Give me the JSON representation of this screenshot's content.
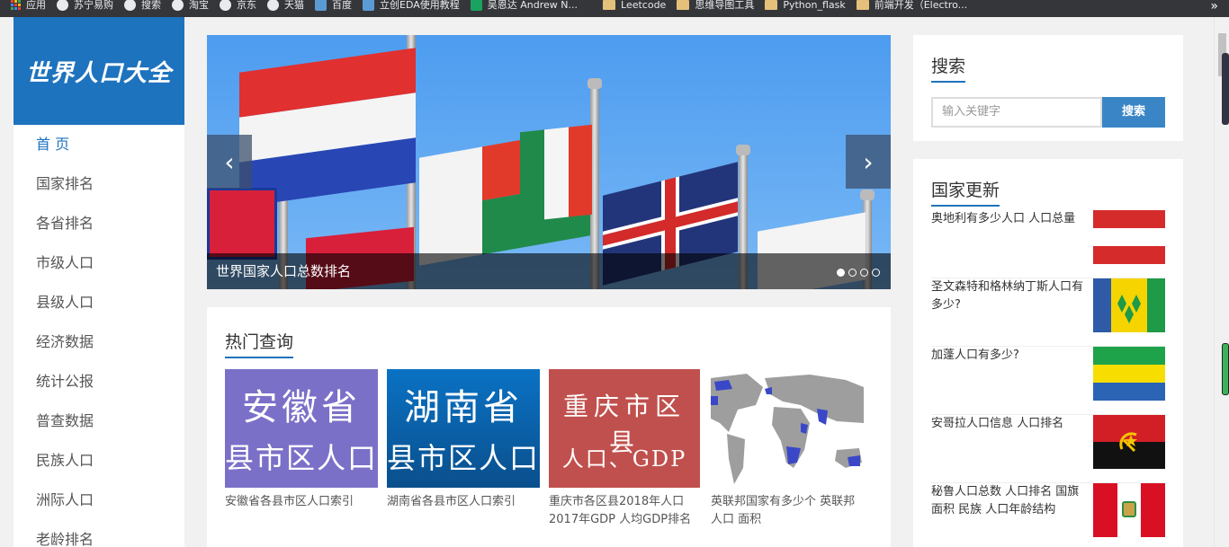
{
  "bookmarks": [
    {
      "label": "应用",
      "icon": "apps-grid-icon"
    },
    {
      "label": "苏宁易购",
      "icon": "globe-icon"
    },
    {
      "label": "搜索",
      "icon": "globe-icon"
    },
    {
      "label": "淘宝",
      "icon": "globe-icon"
    },
    {
      "label": "京东",
      "icon": "globe-icon"
    },
    {
      "label": "天猫",
      "icon": "globe-icon"
    },
    {
      "label": "百度",
      "icon": "baidu-icon"
    },
    {
      "label": "立创EDA使用教程",
      "icon": "link-icon"
    },
    {
      "label": "吴恩达 Andrew N...",
      "icon": "green-site-icon"
    },
    {
      "label": "Leetcode",
      "icon": "folder-icon"
    },
    {
      "label": "思维导图工具",
      "icon": "folder-icon"
    },
    {
      "label": "Python_flask",
      "icon": "folder-icon"
    },
    {
      "label": "前端开发（Electro...",
      "icon": "folder-icon"
    }
  ],
  "bookmarks_more": "»",
  "site": {
    "logo_text": "世界人口大全"
  },
  "nav": [
    {
      "label": "首 页",
      "active": true
    },
    {
      "label": "国家排名"
    },
    {
      "label": "各省排名"
    },
    {
      "label": "市级人口"
    },
    {
      "label": "县级人口"
    },
    {
      "label": "经济数据"
    },
    {
      "label": "统计公报"
    },
    {
      "label": "普查数据"
    },
    {
      "label": "民族人口"
    },
    {
      "label": "洲际人口"
    },
    {
      "label": "老龄排名"
    }
  ],
  "slider": {
    "caption": "世界国家人口总数排名",
    "prev": "‹",
    "next": "›",
    "dots": 4,
    "active_dot": 1
  },
  "hot": {
    "title": "热门查询",
    "cards": [
      {
        "thumb_line1": "安徽省",
        "thumb_line2": "县市区人口",
        "caption": "安徽省各县市区人口索引",
        "bg": "#7b70c8"
      },
      {
        "thumb_line1": "湖南省",
        "thumb_line2": "县市区人口",
        "caption": "湖南省各县市区人口索引",
        "bg": "#0a6ab8"
      },
      {
        "thumb_line1": "重庆市区县",
        "thumb_line2": "人口、GDP",
        "caption": "重庆市各区县2018年人口 2017年GDP 人均GDP排名",
        "bg": "#c0504d"
      },
      {
        "thumb_line1": "",
        "thumb_line2": "",
        "caption": "英联邦国家有多少个 英联邦人口 面积",
        "bg": "#ffffff"
      }
    ]
  },
  "search": {
    "title": "搜索",
    "placeholder": "输入关键字",
    "button": "搜索"
  },
  "updates": {
    "title": "国家更新",
    "items": [
      {
        "text": "奥地利有多少人口 人口总量",
        "flag": "austria-flag"
      },
      {
        "text": "圣文森特和格林纳丁斯人口有多少?",
        "flag": "saint-vincent-flag"
      },
      {
        "text": "加蓬人口有多少?",
        "flag": "gabon-flag"
      },
      {
        "text": "安哥拉人口信息 人口排名",
        "flag": "angola-flag"
      },
      {
        "text": "秘鲁人口总数 人口排名 国旗 面积 民族 人口年龄结构",
        "flag": "peru-flag"
      }
    ]
  },
  "colors": {
    "brand": "#1e73be",
    "button": "#3a85c6"
  }
}
